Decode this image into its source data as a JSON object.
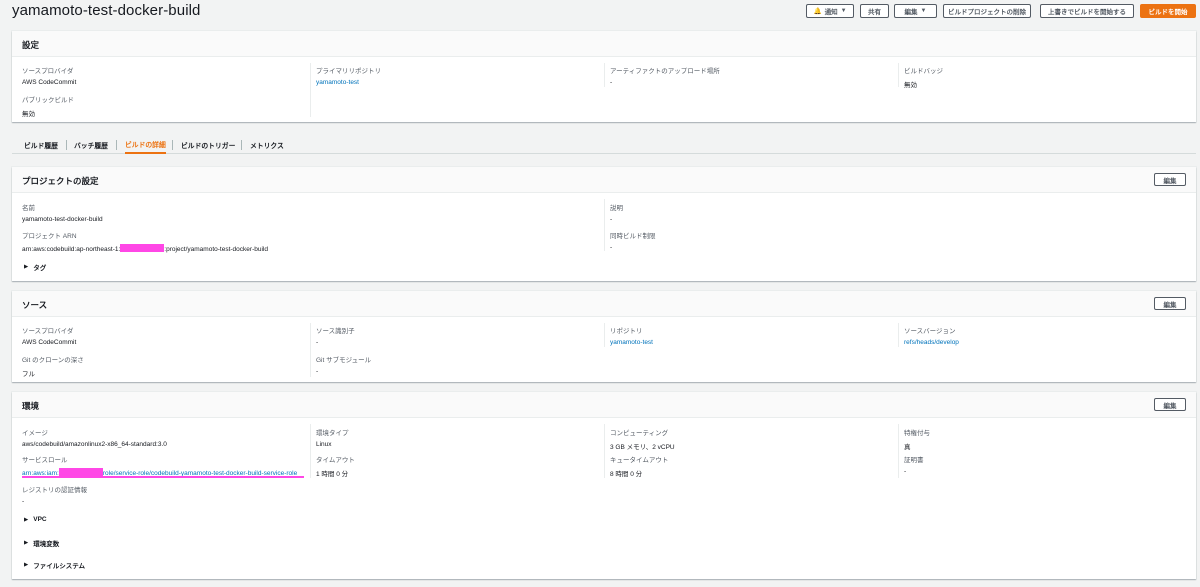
{
  "header": {
    "title": "yamamoto-test-docker-build",
    "buttons": {
      "notify": "通知",
      "share": "共有",
      "edit": "編集",
      "delete": "ビルドプロジェクトの削除",
      "start_override": "上書きでビルドを開始する",
      "start": "ビルドを開始"
    }
  },
  "settings": {
    "title": "設定",
    "source_provider_label": "ソースプロバイダ",
    "source_provider": "AWS CodeCommit",
    "primary_repo_label": "プライマリリポジトリ",
    "primary_repo": "yamamoto-test",
    "artifact_label": "アーティファクトのアップロード場所",
    "artifact": "-",
    "badge_label": "ビルドバッジ",
    "badge": "無効",
    "public_build_label": "パブリックビルド",
    "public_build": "無効"
  },
  "tabs": [
    "ビルド履歴",
    "バッチ履歴",
    "ビルドの詳細",
    "ビルドのトリガー",
    "メトリクス"
  ],
  "project": {
    "title": "プロジェクトの設定",
    "edit": "編集",
    "name_label": "名前",
    "name": "yamamoto-test-docker-build",
    "arn_label": "プロジェクト ARN",
    "arn_prefix": "arn:aws:codebuild:ap-northeast-1:",
    "arn_suffix": ":project/yamamoto-test-docker-build",
    "desc_label": "説明",
    "desc": "-",
    "concurrency_label": "同時ビルド制限",
    "concurrency": "-",
    "tags": "タグ"
  },
  "source": {
    "title": "ソース",
    "edit": "編集",
    "provider_label": "ソースプロバイダ",
    "provider": "AWS CodeCommit",
    "identifier_label": "ソース識別子",
    "identifier": "-",
    "repo_label": "リポジトリ",
    "repo": "yamamoto-test",
    "version_label": "ソースバージョン",
    "version": "refs/heads/develop",
    "clone_depth_label": "Git のクローンの深さ",
    "clone_depth": "フル",
    "submodule_label": "Git サブモジュール",
    "submodule": "-"
  },
  "environment": {
    "title": "環境",
    "edit": "編集",
    "image_label": "イメージ",
    "image": "aws/codebuild/amazonlinux2-x86_64-standard:3.0",
    "env_type_label": "環境タイプ",
    "env_type": "Linux",
    "compute_label": "コンピューティング",
    "compute": "3 GB メモリ、2 vCPU",
    "privileged_label": "特権付与",
    "privileged": "真",
    "role_label": "サービスロール",
    "role_prefix": "arn:aws:iam:",
    "role_suffix": "role/service-role/codebuild-yamamoto-test-docker-build-service-role",
    "timeout_label": "タイムアウト",
    "timeout": "1 時間 0 分",
    "queue_label": "キュータイムアウト",
    "queue": "8 時間 0 分",
    "cert_label": "証明書",
    "cert": "-",
    "registry_label": "レジストリの認証情報",
    "registry": "-",
    "vpc": "VPC",
    "env_vars": "環境変数",
    "filesystem": "ファイルシステム"
  },
  "colors": {
    "accent": "#ec7211",
    "link": "#0073bb",
    "redaction": "#ff47e6"
  }
}
